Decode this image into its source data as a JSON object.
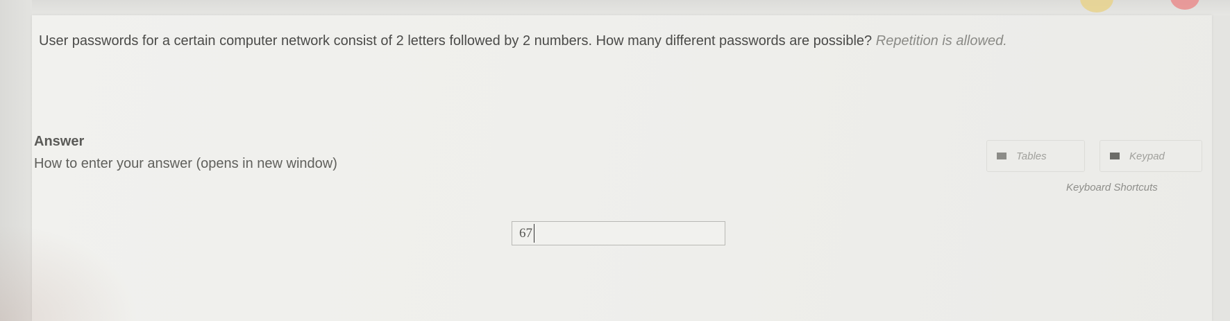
{
  "question": {
    "text": "User passwords for a certain computer network consist of 2 letters followed by 2 numbers.  How many different passwords are possible?",
    "note": "Repetition is allowed."
  },
  "answer": {
    "heading": "Answer",
    "help_link": "How to enter your answer (opens in new window)",
    "input_value": "67"
  },
  "tools": {
    "tables_label": "Tables",
    "keypad_label": "Keypad",
    "shortcuts_label": "Keyboard Shortcuts",
    "icons": [
      "table-icon",
      "keypad-icon"
    ]
  },
  "colors": {
    "background": "#e4e4e1",
    "panel": "#efefec",
    "text": "#4a4a48"
  }
}
